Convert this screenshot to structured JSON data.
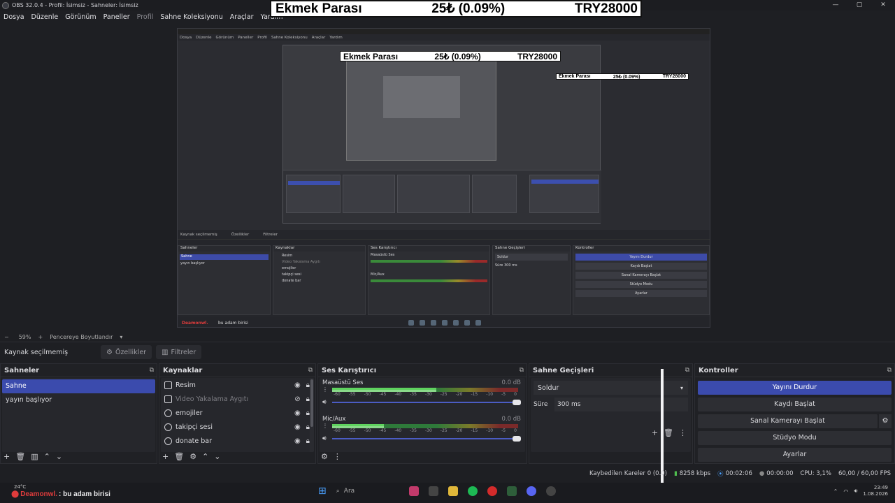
{
  "window": {
    "title": "OBS 32.0.4 - Profil: İsimsiz - Sahneler: İsimsiz",
    "controls": [
      "—",
      "▢",
      "✕"
    ]
  },
  "ticker": {
    "label": "Ekmek Parası",
    "change": "25₺ (0.09%)",
    "price": "TRY28000"
  },
  "menu": {
    "items": [
      "Dosya",
      "Düzenle",
      "Görünüm",
      "Paneller",
      "Profil",
      "Sahne Koleksiyonu",
      "Araçlar",
      "Yardım"
    ]
  },
  "zoom": {
    "minus": "−",
    "value": "59%",
    "plus": "+",
    "mode": "Pencereye Boyutlandır"
  },
  "source_toolbar": {
    "no_selection": "Kaynak seçilmemiş",
    "properties": "Özellikler",
    "filters": "Filtreler"
  },
  "scenes": {
    "title": "Sahneler",
    "items": [
      "Sahne",
      "yayın başlıyor"
    ]
  },
  "sources": {
    "title": "Kaynaklar",
    "items": [
      "Resim",
      "Video Yakalama Aygıtı",
      "emojiler",
      "takipçi sesi",
      "donate bar"
    ]
  },
  "mixer": {
    "title": "Ses Karıştırıcı",
    "channels": [
      {
        "name": "Masaüstü Ses",
        "db": "0.0 dB",
        "level": 0.56
      },
      {
        "name": "Mic/Aux",
        "db": "0.0 dB",
        "level": 0.28
      }
    ],
    "ticks": [
      "-60",
      "-55",
      "-50",
      "-45",
      "-40",
      "-35",
      "-30",
      "-25",
      "-20",
      "-15",
      "-10",
      "-5",
      "0"
    ]
  },
  "transitions": {
    "title": "Sahne Geçişleri",
    "selected": "Soldur",
    "duration_label": "Süre",
    "duration_value": "300 ms"
  },
  "controls": {
    "title": "Kontroller",
    "stop_stream": "Yayını Durdur",
    "start_record": "Kaydı Başlat",
    "virtual_cam": "Sanal Kamerayı Başlat",
    "studio_mode": "Stüdyo Modu",
    "settings": "Ayarlar"
  },
  "status": {
    "dropped": "Kaybedilen Kareler 0 (0.0)",
    "bitrate": "8258 kbps",
    "stream_time": "00:02:06",
    "record_time": "00:00:00",
    "cpu": "CPU: 3,1%",
    "fps": "60,00 / 60,00 FPS"
  },
  "taskbar": {
    "temperature": "24°C",
    "donor": "Deamonwl.",
    "message": ": bu adam birisi",
    "search_placeholder": "Ara",
    "time": "23:49",
    "date": "1.08.2026"
  },
  "preview": {
    "menu": [
      "Dosya",
      "Düzenle",
      "Görünüm",
      "Paneller",
      "Profil",
      "Sahne Koleksiyonu",
      "Araçlar",
      "Yardım"
    ],
    "no_selection": "Kaynak seçilmemiş",
    "properties": "Özellikler",
    "filters": "Filtreler",
    "scenes_title": "Sahneler",
    "scene_items": [
      "Sahne",
      "yayın başlıyor"
    ],
    "sources_title": "Kaynaklar",
    "source_items": [
      "Resim",
      "Video Yakalama Aygıtı",
      "emojiler",
      "takipçi sesi",
      "donate bar"
    ],
    "mixer_title": "Ses Karıştırıcı",
    "mixer_ch1": "Masaüstü Ses",
    "mixer_ch2": "Mic/Aux",
    "transitions_title": "Sahne Geçişleri",
    "transition": "Soldur",
    "duration_label": "Süre",
    "duration": "300 ms",
    "controls_title": "Kontroller",
    "btns": [
      "Yayını Durdur",
      "Kaydı Başlat",
      "Sanal Kamerayı Başlat",
      "Stüdyo Modu",
      "Ayarlar"
    ],
    "zoom": "59%",
    "zoom_mode": "Pencereye Boyutlandır",
    "donor": "Deamonwl.",
    "message": "bu adam birisi"
  }
}
